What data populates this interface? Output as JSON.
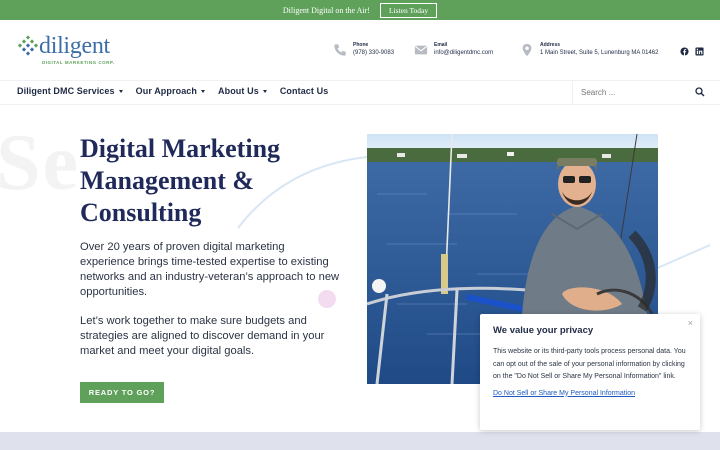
{
  "topbar": {
    "message": "Diligent Digital on the Air!",
    "button": "Listen Today"
  },
  "logo": {
    "name": "diligent",
    "tagline": "DIGITAL MARKETING CORP."
  },
  "contact": {
    "phone": {
      "label": "Phone",
      "value": "(978) 330-9083"
    },
    "email": {
      "label": "Email",
      "value": "info@diligentdmc.com"
    },
    "address": {
      "label": "Address",
      "value": "1 Main Street, Suite 5, Lunenburg MA 01462"
    }
  },
  "nav": {
    "items": [
      {
        "label": "Diligent DMC Services"
      },
      {
        "label": "Our Approach"
      },
      {
        "label": "About Us"
      },
      {
        "label": "Contact Us"
      }
    ]
  },
  "search": {
    "placeholder": "Search ..."
  },
  "hero": {
    "ghost": "Se",
    "title": "Digital Marketing Management & Consulting",
    "p1": "Over 20 years of proven digital marketing experience brings time-tested expertise to existing networks and an industry-veteran’s approach to new opportunities.",
    "p2": "Let’s work together to make sure budgets and strategies are aligned to discover demand in your market and meet your digital goals.",
    "cta": "READY TO GO?"
  },
  "privacy": {
    "title": "We value your privacy",
    "body": "This website or its third-party tools process personal data. You can opt out of the sale of your personal information by clicking on the \"Do Not Sell or Share My Personal Information\" link.",
    "link": "Do Not Sell or Share My Personal Information",
    "close": "×"
  },
  "colors": {
    "accent_green": "#5fa15b",
    "brand_blue": "#3e6ea8",
    "navy": "#1f2a5a",
    "link": "#1e5bbf"
  }
}
